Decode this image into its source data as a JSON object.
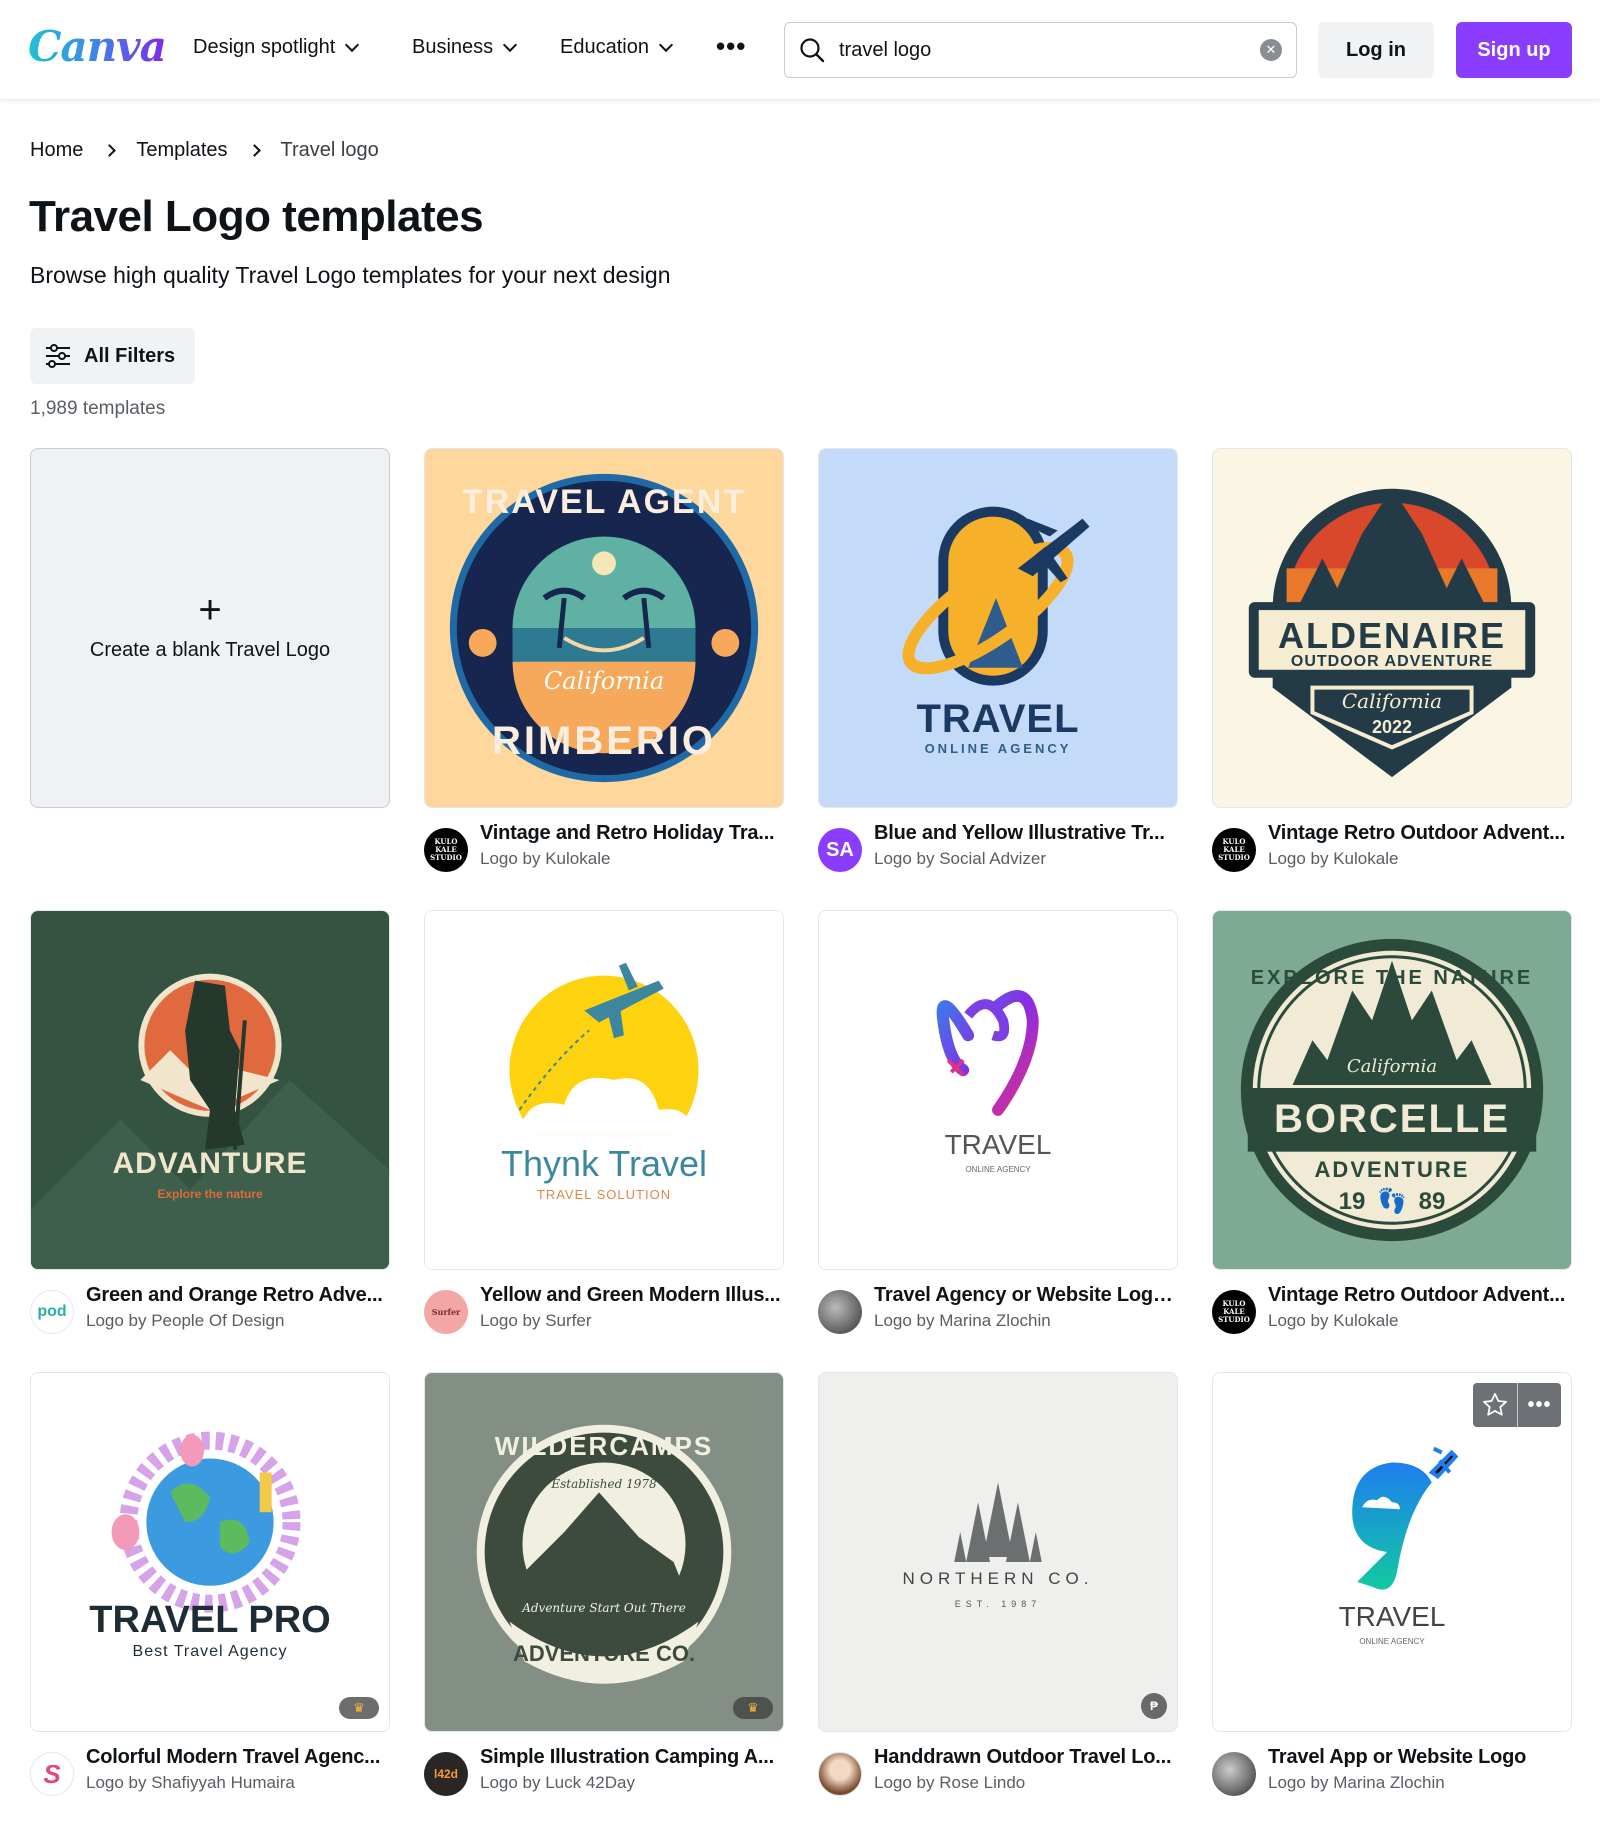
{
  "header": {
    "logo": "Canva",
    "nav": [
      {
        "label": "Design spotlight"
      },
      {
        "label": "Business"
      },
      {
        "label": "Education"
      }
    ],
    "more_icon": "more-horizontal-icon",
    "search": {
      "value": "travel logo",
      "placeholder": ""
    },
    "login_label": "Log in",
    "signup_label": "Sign up",
    "colors": {
      "brand_purple": "#8b3dff"
    }
  },
  "breadcrumb": [
    {
      "label": "Home"
    },
    {
      "label": "Templates"
    },
    {
      "label": "Travel logo"
    }
  ],
  "page": {
    "title": "Travel Logo templates",
    "subtitle": "Browse high quality Travel Logo templates for your next design",
    "filters_label": "All Filters",
    "count": "1,989 templates"
  },
  "blank_card": {
    "label": "Create a blank Travel Logo",
    "icon": "plus-icon"
  },
  "templates": [
    {
      "title": "Vintage and Retro Holiday Tra...",
      "author": "Logo by Kulokale",
      "avatar_text": "KULO KALE STUDIO",
      "art": {
        "top_text": "TRAVEL AGENT",
        "script": "California",
        "bottom_text": "RIMBERIO",
        "bg": "#fdd79c"
      }
    },
    {
      "title": "Blue and Yellow Illustrative Tr...",
      "author": "Logo by Social Advizer",
      "avatar_text": "SA",
      "art": {
        "main": "TRAVEL",
        "sub": "ONLINE AGENCY",
        "bg": "#c3dbf8"
      }
    },
    {
      "title": "Vintage Retro Outdoor Advent...",
      "author": "Logo by Kulokale",
      "avatar_text": "KULO KALE STUDIO",
      "art": {
        "main": "ALDENAIRE",
        "sub": "OUTDOOR ADVENTURE",
        "script": "California",
        "year": "2022",
        "bg": "#fbf5e4"
      }
    },
    {
      "title": "Green and Orange Retro Adve...",
      "author": "Logo by People Of Design",
      "avatar_text": "pod",
      "art": {
        "main": "ADVANTURE",
        "sub": "Explore the nature",
        "bg": "#345441"
      }
    },
    {
      "title": "Yellow and Green Modern Illus...",
      "author": "Logo by Surfer",
      "avatar_text": "Surfer",
      "art": {
        "main": "Thynk Travel",
        "sub": "TRAVEL SOLUTION",
        "bg": "#ffffff"
      }
    },
    {
      "title": "Travel Agency or Website Logo...",
      "author": "Logo by Marina Zlochin",
      "avatar_text": "",
      "art": {
        "main": "TRAVEL",
        "sub": "ONLINE AGENCY",
        "bg": "#ffffff"
      }
    },
    {
      "title": "Vintage Retro Outdoor Advent...",
      "author": "Logo by Kulokale",
      "avatar_text": "KULO KALE STUDIO",
      "art": {
        "top_text": "EXPLORE THE NATURE",
        "script": "California",
        "main": "BORCELLE",
        "sub": "ADVENTURE",
        "year_left": "19",
        "year_right": "89",
        "bg": "#7ea993"
      }
    },
    {
      "title": "Colorful Modern Travel Agenc...",
      "author": "Logo by Shafiyyah Humaira",
      "avatar_text": "S",
      "premium": true,
      "art": {
        "main": "TRAVEL PRO",
        "sub": "Best Travel Agency",
        "bg": "#ffffff"
      }
    },
    {
      "title": "Simple Illustration Camping A...",
      "author": "Logo by Luck 42Day",
      "avatar_text": "l42d",
      "premium": true,
      "art": {
        "top_text": "WILDERCAMPS",
        "established": "Established 1978",
        "script": "Adventure Start Out There",
        "bottom_text": "ADVENTURE CO.",
        "bg": "#838e84"
      }
    },
    {
      "title": "Handdrawn Outdoor Travel Lo...",
      "author": "Logo by Rose Lindo",
      "avatar_text": "",
      "paid": true,
      "paid_symbol": "₱",
      "art": {
        "main": "NORTHERN CO.",
        "sub": "EST. 1987",
        "bg": "#efefed"
      }
    },
    {
      "title": "Travel App or Website Logo",
      "author": "Logo by Marina Zlochin",
      "avatar_text": "",
      "hovered": true,
      "art": {
        "main": "TRAVEL",
        "sub": "ONLINE AGENCY",
        "bg": "#ffffff"
      }
    }
  ]
}
